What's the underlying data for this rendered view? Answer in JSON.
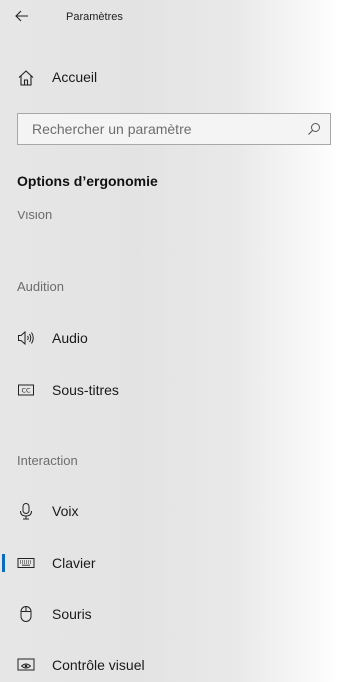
{
  "header": {
    "title": "Paramètres",
    "back_icon": "back-arrow-icon"
  },
  "home": {
    "label": "Accueil",
    "icon": "home-icon"
  },
  "search": {
    "placeholder": "Rechercher un paramètre",
    "value": "",
    "icon": "search-icon"
  },
  "section_title": "Options d’ergonomie",
  "groups": {
    "vision": "Vision",
    "audition": "Audition",
    "interaction": "Interaction"
  },
  "items": {
    "audio": {
      "label": "Audio",
      "icon": "speaker-icon"
    },
    "subtitles": {
      "label": "Sous-titres",
      "icon": "closed-captions-icon"
    },
    "voice": {
      "label": "Voix",
      "icon": "microphone-icon"
    },
    "keyboard": {
      "label": "Clavier",
      "icon": "keyboard-icon",
      "selected": true
    },
    "mouse": {
      "label": "Souris",
      "icon": "mouse-icon"
    },
    "eye_control": {
      "label": "Contrôle visuel",
      "icon": "eye-control-icon"
    }
  },
  "colors": {
    "accent": "#0b6cbd",
    "group_label": "#6d6d6d"
  }
}
